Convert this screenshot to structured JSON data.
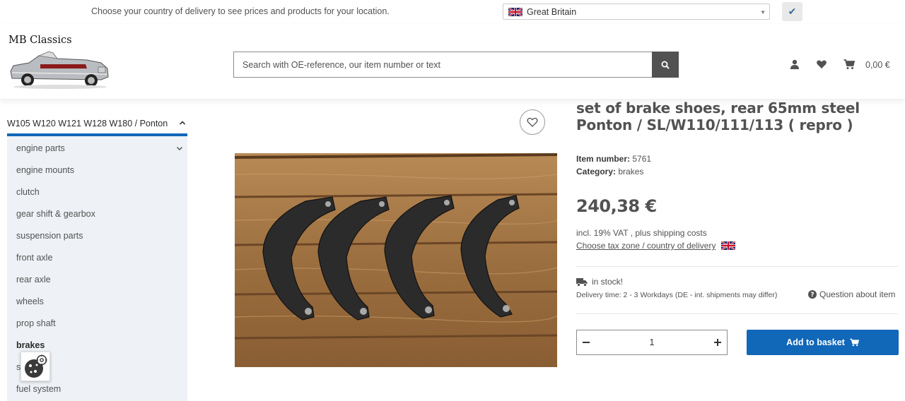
{
  "topbar": {
    "message": "Choose your country of delivery to see prices and products for your location.",
    "country_selected": "Great Britain",
    "confirm_symbol": "✔"
  },
  "header": {
    "logo_text": "MB Classics",
    "search_placeholder": "Search with OE-reference, our item number or text",
    "basket_amount": "0,00 €"
  },
  "sidebar": {
    "category_heading": "W105 W120 W121 W128 W180 / Ponton",
    "items": [
      {
        "label": "engine parts"
      },
      {
        "label": "engine mounts"
      },
      {
        "label": "clutch"
      },
      {
        "label": "gear shift & gearbox"
      },
      {
        "label": "suspension parts"
      },
      {
        "label": "front axle"
      },
      {
        "label": "rear axle"
      },
      {
        "label": "wheels"
      },
      {
        "label": "prop shaft"
      },
      {
        "label": "brakes"
      },
      {
        "label": "s"
      },
      {
        "label": "fuel system"
      }
    ]
  },
  "product": {
    "title": "set of brake shoes, rear 65mm steel Ponton / SL/W110/111/113 ( repro )",
    "item_number_label": "Item number:",
    "item_number": "5761",
    "category_label": "Category:",
    "category": "brakes",
    "price": "240,38 €",
    "vat_text": "incl. 19% VAT , plus shipping costs",
    "tax_zone_link": "Choose tax zone / country of delivery",
    "stock_text": "in stock!",
    "delivery_text": "Delivery time: 2 - 3 Workdays",
    "delivery_note": "(DE - int. shipments may differ)",
    "question_link": "Question about item",
    "quantity": "1",
    "add_to_basket": "Add to basket"
  },
  "colors": {
    "accent": "#1167b8",
    "text": "#525252",
    "sidebar_bg": "#eef2f6"
  }
}
